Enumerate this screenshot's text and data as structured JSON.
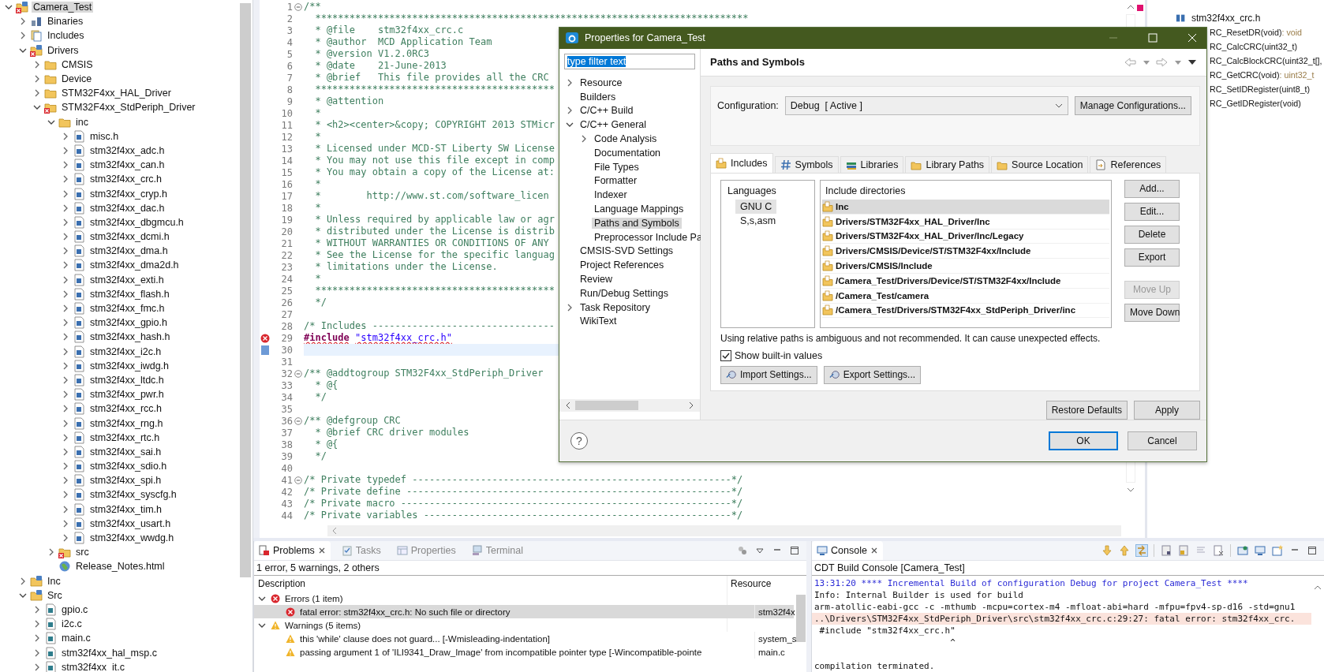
{
  "explorer": {
    "items": [
      {
        "label": "Camera_Test",
        "kind": "project-error",
        "expanded": true,
        "selected": true,
        "children": [
          {
            "label": "Binaries",
            "kind": "binaries",
            "expanded": false,
            "selected": false
          },
          {
            "label": "Includes",
            "kind": "includes",
            "expanded": false,
            "selected": false
          },
          {
            "label": "Drivers",
            "kind": "source-folder-error",
            "expanded": true,
            "selected": false,
            "children": [
              {
                "label": "CMSIS",
                "kind": "folder",
                "expanded": false,
                "selected": false
              },
              {
                "label": "Device",
                "kind": "folder",
                "expanded": false,
                "selected": false
              },
              {
                "label": "STM32F4xx_HAL_Driver",
                "kind": "folder",
                "expanded": false,
                "selected": false
              },
              {
                "label": "STM32F4xx_StdPeriph_Driver",
                "kind": "folder-error",
                "expanded": true,
                "selected": false,
                "children": [
                  {
                    "label": "inc",
                    "kind": "folder",
                    "expanded": true,
                    "selected": false,
                    "children": [
                      {
                        "label": "misc.h",
                        "kind": "header",
                        "expanded": false,
                        "selected": false
                      },
                      {
                        "label": "stm32f4xx_adc.h",
                        "kind": "header",
                        "expanded": false,
                        "selected": false
                      },
                      {
                        "label": "stm32f4xx_can.h",
                        "kind": "header",
                        "expanded": false,
                        "selected": false
                      },
                      {
                        "label": "stm32f4xx_crc.h",
                        "kind": "header",
                        "expanded": false,
                        "selected": false
                      },
                      {
                        "label": "stm32f4xx_cryp.h",
                        "kind": "header",
                        "expanded": false,
                        "selected": false
                      },
                      {
                        "label": "stm32f4xx_dac.h",
                        "kind": "header",
                        "expanded": false,
                        "selected": false
                      },
                      {
                        "label": "stm32f4xx_dbgmcu.h",
                        "kind": "header",
                        "expanded": false,
                        "selected": false
                      },
                      {
                        "label": "stm32f4xx_dcmi.h",
                        "kind": "header",
                        "expanded": false,
                        "selected": false
                      },
                      {
                        "label": "stm32f4xx_dma.h",
                        "kind": "header",
                        "expanded": false,
                        "selected": false
                      },
                      {
                        "label": "stm32f4xx_dma2d.h",
                        "kind": "header",
                        "expanded": false,
                        "selected": false
                      },
                      {
                        "label": "stm32f4xx_exti.h",
                        "kind": "header",
                        "expanded": false,
                        "selected": false
                      },
                      {
                        "label": "stm32f4xx_flash.h",
                        "kind": "header",
                        "expanded": false,
                        "selected": false
                      },
                      {
                        "label": "stm32f4xx_fmc.h",
                        "kind": "header",
                        "expanded": false,
                        "selected": false
                      },
                      {
                        "label": "stm32f4xx_gpio.h",
                        "kind": "header",
                        "expanded": false,
                        "selected": false
                      },
                      {
                        "label": "stm32f4xx_hash.h",
                        "kind": "header",
                        "expanded": false,
                        "selected": false
                      },
                      {
                        "label": "stm32f4xx_i2c.h",
                        "kind": "header",
                        "expanded": false,
                        "selected": false
                      },
                      {
                        "label": "stm32f4xx_iwdg.h",
                        "kind": "header",
                        "expanded": false,
                        "selected": false
                      },
                      {
                        "label": "stm32f4xx_ltdc.h",
                        "kind": "header",
                        "expanded": false,
                        "selected": false
                      },
                      {
                        "label": "stm32f4xx_pwr.h",
                        "kind": "header",
                        "expanded": false,
                        "selected": false
                      },
                      {
                        "label": "stm32f4xx_rcc.h",
                        "kind": "header",
                        "expanded": false,
                        "selected": false
                      },
                      {
                        "label": "stm32f4xx_rng.h",
                        "kind": "header",
                        "expanded": false,
                        "selected": false
                      },
                      {
                        "label": "stm32f4xx_rtc.h",
                        "kind": "header",
                        "expanded": false,
                        "selected": false
                      },
                      {
                        "label": "stm32f4xx_sai.h",
                        "kind": "header",
                        "expanded": false,
                        "selected": false
                      },
                      {
                        "label": "stm32f4xx_sdio.h",
                        "kind": "header",
                        "expanded": false,
                        "selected": false
                      },
                      {
                        "label": "stm32f4xx_spi.h",
                        "kind": "header",
                        "expanded": false,
                        "selected": false
                      },
                      {
                        "label": "stm32f4xx_syscfg.h",
                        "kind": "header",
                        "expanded": false,
                        "selected": false
                      },
                      {
                        "label": "stm32f4xx_tim.h",
                        "kind": "header",
                        "expanded": false,
                        "selected": false
                      },
                      {
                        "label": "stm32f4xx_usart.h",
                        "kind": "header",
                        "expanded": false,
                        "selected": false
                      },
                      {
                        "label": "stm32f4xx_wwdg.h",
                        "kind": "header",
                        "expanded": false,
                        "selected": false
                      }
                    ]
                  },
                  {
                    "label": "src",
                    "kind": "folder-error",
                    "expanded": false,
                    "selected": false
                  },
                  {
                    "label": "Release_Notes.html",
                    "kind": "html",
                    "selected": false
                  }
                ]
              }
            ]
          },
          {
            "label": "Inc",
            "kind": "source-folder",
            "expanded": false,
            "selected": false
          },
          {
            "label": "Src",
            "kind": "source-folder",
            "expanded": true,
            "selected": false,
            "children": [
              {
                "label": "gpio.c",
                "kind": "source",
                "expanded": false,
                "selected": false
              },
              {
                "label": "i2c.c",
                "kind": "source",
                "expanded": false,
                "selected": false
              },
              {
                "label": "main.c",
                "kind": "source",
                "expanded": false,
                "selected": false
              },
              {
                "label": "stm32f4xx_hal_msp.c",
                "kind": "source",
                "expanded": false,
                "selected": false
              },
              {
                "label": "stm32f4xx_it.c",
                "kind": "source",
                "expanded": false,
                "selected": false
              }
            ]
          }
        ]
      }
    ]
  },
  "editor": {
    "lines": [
      {
        "number": "1",
        "text": "/**",
        "kind": "comment",
        "fold": true
      },
      {
        "number": "2",
        "text": "  ****************************************************************************",
        "kind": "comment",
        "fold": false
      },
      {
        "number": "3",
        "text": "  * @file    stm32f4xx_crc.c",
        "kind": "comment",
        "fold": false
      },
      {
        "number": "4",
        "text": "  * @author  MCD Application Team",
        "kind": "comment",
        "fold": false
      },
      {
        "number": "5",
        "text": "  * @version V1.2.0RC3",
        "kind": "comment",
        "fold": false
      },
      {
        "number": "6",
        "text": "  * @date    21-June-2013",
        "kind": "comment",
        "fold": false
      },
      {
        "number": "7",
        "text": "  * @brief   This file provides all the CRC",
        "kind": "comment",
        "fold": false
      },
      {
        "number": "8",
        "text": "  ******************************************",
        "kind": "comment",
        "fold": false
      },
      {
        "number": "9",
        "text": "  * @attention",
        "kind": "comment",
        "fold": false
      },
      {
        "number": "10",
        "text": "  *",
        "kind": "comment",
        "fold": false
      },
      {
        "number": "11",
        "text": "  * <h2><center>&copy; COPYRIGHT 2013 STMicr",
        "kind": "comment",
        "fold": false
      },
      {
        "number": "12",
        "text": "  *",
        "kind": "comment",
        "fold": false
      },
      {
        "number": "13",
        "text": "  * Licensed under MCD-ST Liberty SW License",
        "kind": "comment",
        "fold": false
      },
      {
        "number": "14",
        "text": "  * You may not use this file except in comp",
        "kind": "comment",
        "fold": false
      },
      {
        "number": "15",
        "text": "  * You may obtain a copy of the License at:",
        "kind": "comment",
        "fold": false
      },
      {
        "number": "16",
        "text": "  *",
        "kind": "comment",
        "fold": false
      },
      {
        "number": "17",
        "text": "  *        http://www.st.com/software_licen",
        "kind": "comment",
        "fold": false
      },
      {
        "number": "18",
        "text": "  *",
        "kind": "comment",
        "fold": false
      },
      {
        "number": "19",
        "text": "  * Unless required by applicable law or agr",
        "kind": "comment",
        "fold": false
      },
      {
        "number": "20",
        "text": "  * distributed under the License is distrib",
        "kind": "comment",
        "fold": false
      },
      {
        "number": "21",
        "text": "  * WITHOUT WARRANTIES OR CONDITIONS OF ANY",
        "kind": "comment",
        "fold": false
      },
      {
        "number": "22",
        "text": "  * See the License for the specific languag",
        "kind": "comment",
        "fold": false
      },
      {
        "number": "23",
        "text": "  * limitations under the License.",
        "kind": "comment",
        "fold": false
      },
      {
        "number": "24",
        "text": "  *",
        "kind": "comment",
        "fold": false
      },
      {
        "number": "25",
        "text": "  ******************************************",
        "kind": "comment",
        "fold": false
      },
      {
        "number": "26",
        "text": "  */",
        "kind": "comment",
        "fold": false
      },
      {
        "number": "27",
        "kind": "blank",
        "fold": false
      },
      {
        "number": "28",
        "text": "/* Includes --------------------------------",
        "kind": "comment",
        "fold": false
      },
      {
        "number": "29",
        "directive": "#include",
        "target": "\"stm32f4xx_crc.h\"",
        "kind": "include-error",
        "fold": false
      },
      {
        "number": "30",
        "kind": "current",
        "fold": false
      },
      {
        "number": "31",
        "kind": "blank",
        "fold": false
      },
      {
        "number": "32",
        "text": "/** @addtogroup STM32F4xx_StdPeriph_Driver",
        "kind": "comment",
        "fold": true
      },
      {
        "number": "33",
        "text": "  * @{",
        "kind": "comment",
        "fold": false
      },
      {
        "number": "34",
        "text": "  */",
        "kind": "comment",
        "fold": false
      },
      {
        "number": "35",
        "kind": "blank",
        "fold": false
      },
      {
        "number": "36",
        "text": "/** @defgroup CRC",
        "kind": "comment",
        "fold": true
      },
      {
        "number": "37",
        "text": "  * @brief CRC driver modules",
        "kind": "comment",
        "fold": false
      },
      {
        "number": "38",
        "text": "  * @{",
        "kind": "comment",
        "fold": false
      },
      {
        "number": "39",
        "text": "  */",
        "kind": "comment",
        "fold": false
      },
      {
        "number": "40",
        "kind": "blank",
        "fold": false
      },
      {
        "number": "41",
        "text": "/* Private typedef --------------------------------------------------------*/",
        "kind": "comment",
        "fold": true
      },
      {
        "number": "42",
        "text": "/* Private define ---------------------------------------------------------*/",
        "kind": "comment",
        "fold": false
      },
      {
        "number": "43",
        "text": "/* Private macro ----------------------------------------------------------*/",
        "kind": "comment",
        "fold": false
      },
      {
        "number": "44",
        "text": "/* Private variables ------------------------------------------------------*/",
        "kind": "comment",
        "fold": false
      }
    ]
  },
  "outline": {
    "file": "stm32f4xx_crc.h",
    "items": [
      {
        "name": "RC_ResetDR(void)",
        "type": ": void"
      },
      {
        "name": "RC_CalcCRC(uint32_t)"
      },
      {
        "name": "RC_CalcBlockCRC(uint32_t[],"
      },
      {
        "name": "RC_GetCRC(void)",
        "type": ": uint32_t"
      },
      {
        "name": "RC_SetIDRegister(uint8_t)"
      },
      {
        "name": "RC_GetIDRegister(void)"
      }
    ]
  },
  "problems": {
    "tabs": [
      {
        "label": "Problems",
        "kind": "problems",
        "selected": true
      },
      {
        "label": "Tasks",
        "kind": "tasks",
        "selected": false
      },
      {
        "label": "Properties",
        "kind": "properties",
        "selected": false
      },
      {
        "label": "Terminal",
        "kind": "terminal",
        "selected": false
      }
    ],
    "summary": "1 error, 5 warnings, 2 others",
    "columns": [
      "Description",
      "Resource"
    ],
    "groups": [
      {
        "label": "Errors (1 item)",
        "kind": "error",
        "expanded": true,
        "rows": [
          {
            "description": "fatal error: stm32f4xx_crc.h: No such file or directory",
            "resource": "stm32f4x",
            "selected": true
          }
        ]
      },
      {
        "label": "Warnings (5 items)",
        "kind": "warning",
        "expanded": true,
        "rows": [
          {
            "description": "this 'while' clause does not guard... [-Wmisleading-indentation]",
            "resource": "system_s",
            "selected": false
          },
          {
            "description": "passing argument 1 of 'ILI9341_Draw_Image' from incompatible pointer type [-Wincompatible-pointe",
            "resource": "main.c",
            "selected": false
          }
        ]
      }
    ]
  },
  "console": {
    "tab": "Console",
    "title": "CDT Build Console [Camera_Test]",
    "lines": [
      {
        "text": "13:31:20 **** Incremental Build of configuration Debug for project Camera_Test ****",
        "kind": "info"
      },
      {
        "text": "Info: Internal Builder is used for build",
        "kind": "plain"
      },
      {
        "text": "arm-atollic-eabi-gcc -c -mthumb -mcpu=cortex-m4 -mfloat-abi=hard -mfpu=fpv4-sp-d16 -std=gnu1",
        "kind": "plain"
      },
      {
        "text": "..\\Drivers\\STM32F4xx_StdPeriph_Driver\\src\\stm32f4xx_crc.c:29:27: fatal error: stm32f4xx_crc.",
        "kind": "error"
      },
      {
        "text": " #include \"stm32f4xx_crc.h\"",
        "kind": "plain"
      },
      {
        "text": "                          ^",
        "kind": "plain"
      },
      {
        "kind": "blank"
      },
      {
        "text": "compilation terminated.",
        "kind": "plain"
      }
    ]
  },
  "dialog": {
    "title": "Properties for Camera_Test",
    "filter": {
      "value": "type filter text"
    },
    "nav": [
      {
        "label": "Resource",
        "expanded": false,
        "selected": false
      },
      {
        "label": "Builders",
        "selected": false
      },
      {
        "label": "C/C++ Build",
        "expanded": false,
        "selected": false
      },
      {
        "label": "C/C++ General",
        "expanded": true,
        "selected": false,
        "children": [
          {
            "label": "Code Analysis",
            "expanded": false,
            "selected": false
          },
          {
            "label": "Documentation",
            "selected": false
          },
          {
            "label": "File Types",
            "selected": false
          },
          {
            "label": "Formatter",
            "selected": false
          },
          {
            "label": "Indexer",
            "selected": false
          },
          {
            "label": "Language Mappings",
            "selected": false
          },
          {
            "label": "Paths and Symbols",
            "selected": true
          },
          {
            "label": "Preprocessor Include Pa",
            "selected": false
          }
        ]
      },
      {
        "label": "CMSIS-SVD Settings",
        "selected": false
      },
      {
        "label": "Project References",
        "selected": false
      },
      {
        "label": "Review",
        "selected": false
      },
      {
        "label": "Run/Debug Settings",
        "selected": false
      },
      {
        "label": "Task Repository",
        "expanded": false,
        "selected": false
      },
      {
        "label": "WikiText",
        "selected": false
      }
    ],
    "page_title": "Paths and Symbols",
    "configuration": {
      "label": "Configuration:",
      "value": "Debug  [ Active ]",
      "button": "Manage Configurations..."
    },
    "tabs": [
      {
        "label": "Includes",
        "kind": "includes",
        "selected": true
      },
      {
        "label": "Symbols",
        "kind": "symbols",
        "selected": false
      },
      {
        "label": "Libraries",
        "kind": "libraries",
        "selected": false
      },
      {
        "label": "Library Paths",
        "kind": "library-paths",
        "selected": false
      },
      {
        "label": "Source Location",
        "kind": "source-location",
        "selected": false
      },
      {
        "label": "References",
        "kind": "references",
        "selected": false
      }
    ],
    "languages": {
      "header": "Languages",
      "items": [
        {
          "label": "GNU C",
          "selected": true
        },
        {
          "label": "S,s,asm",
          "selected": false
        }
      ]
    },
    "include_directories": {
      "header": "Include directories",
      "items": [
        {
          "label": "Inc",
          "selected": true
        },
        {
          "label": "Drivers/STM32F4xx_HAL_Driver/Inc",
          "selected": false
        },
        {
          "label": "Drivers/STM32F4xx_HAL_Driver/Inc/Legacy",
          "selected": false
        },
        {
          "label": "Drivers/CMSIS/Device/ST/STM32F4xx/Include",
          "selected": false
        },
        {
          "label": "Drivers/CMSIS/Include",
          "selected": false
        },
        {
          "label": "/Camera_Test/Drivers/Device/ST/STM32F4xx/Include",
          "selected": false
        },
        {
          "label": "/Camera_Test/camera",
          "selected": false
        },
        {
          "label": "/Camera_Test/Drivers/STM32F4xx_StdPeriph_Driver/inc",
          "selected": false
        }
      ]
    },
    "side_buttons": [
      {
        "label": "Add...",
        "disabled": false
      },
      {
        "label": "Edit...",
        "disabled": false
      },
      {
        "label": "Delete",
        "disabled": false
      },
      {
        "label": "Export",
        "disabled": false
      },
      {
        "label": "Move Up",
        "disabled": true
      },
      {
        "label": "Move Down",
        "disabled": false
      }
    ],
    "note": "Using relative paths is ambiguous and not recommended. It can cause unexpected effects.",
    "show_builtin": {
      "label": "Show built-in values",
      "checked": true
    },
    "settings_buttons": [
      "Import Settings...",
      "Export Settings..."
    ],
    "page_buttons": [
      "Restore Defaults",
      "Apply"
    ],
    "help": "?",
    "footer_buttons": [
      {
        "label": "OK",
        "default": true
      },
      {
        "label": "Cancel",
        "default": false
      }
    ]
  }
}
